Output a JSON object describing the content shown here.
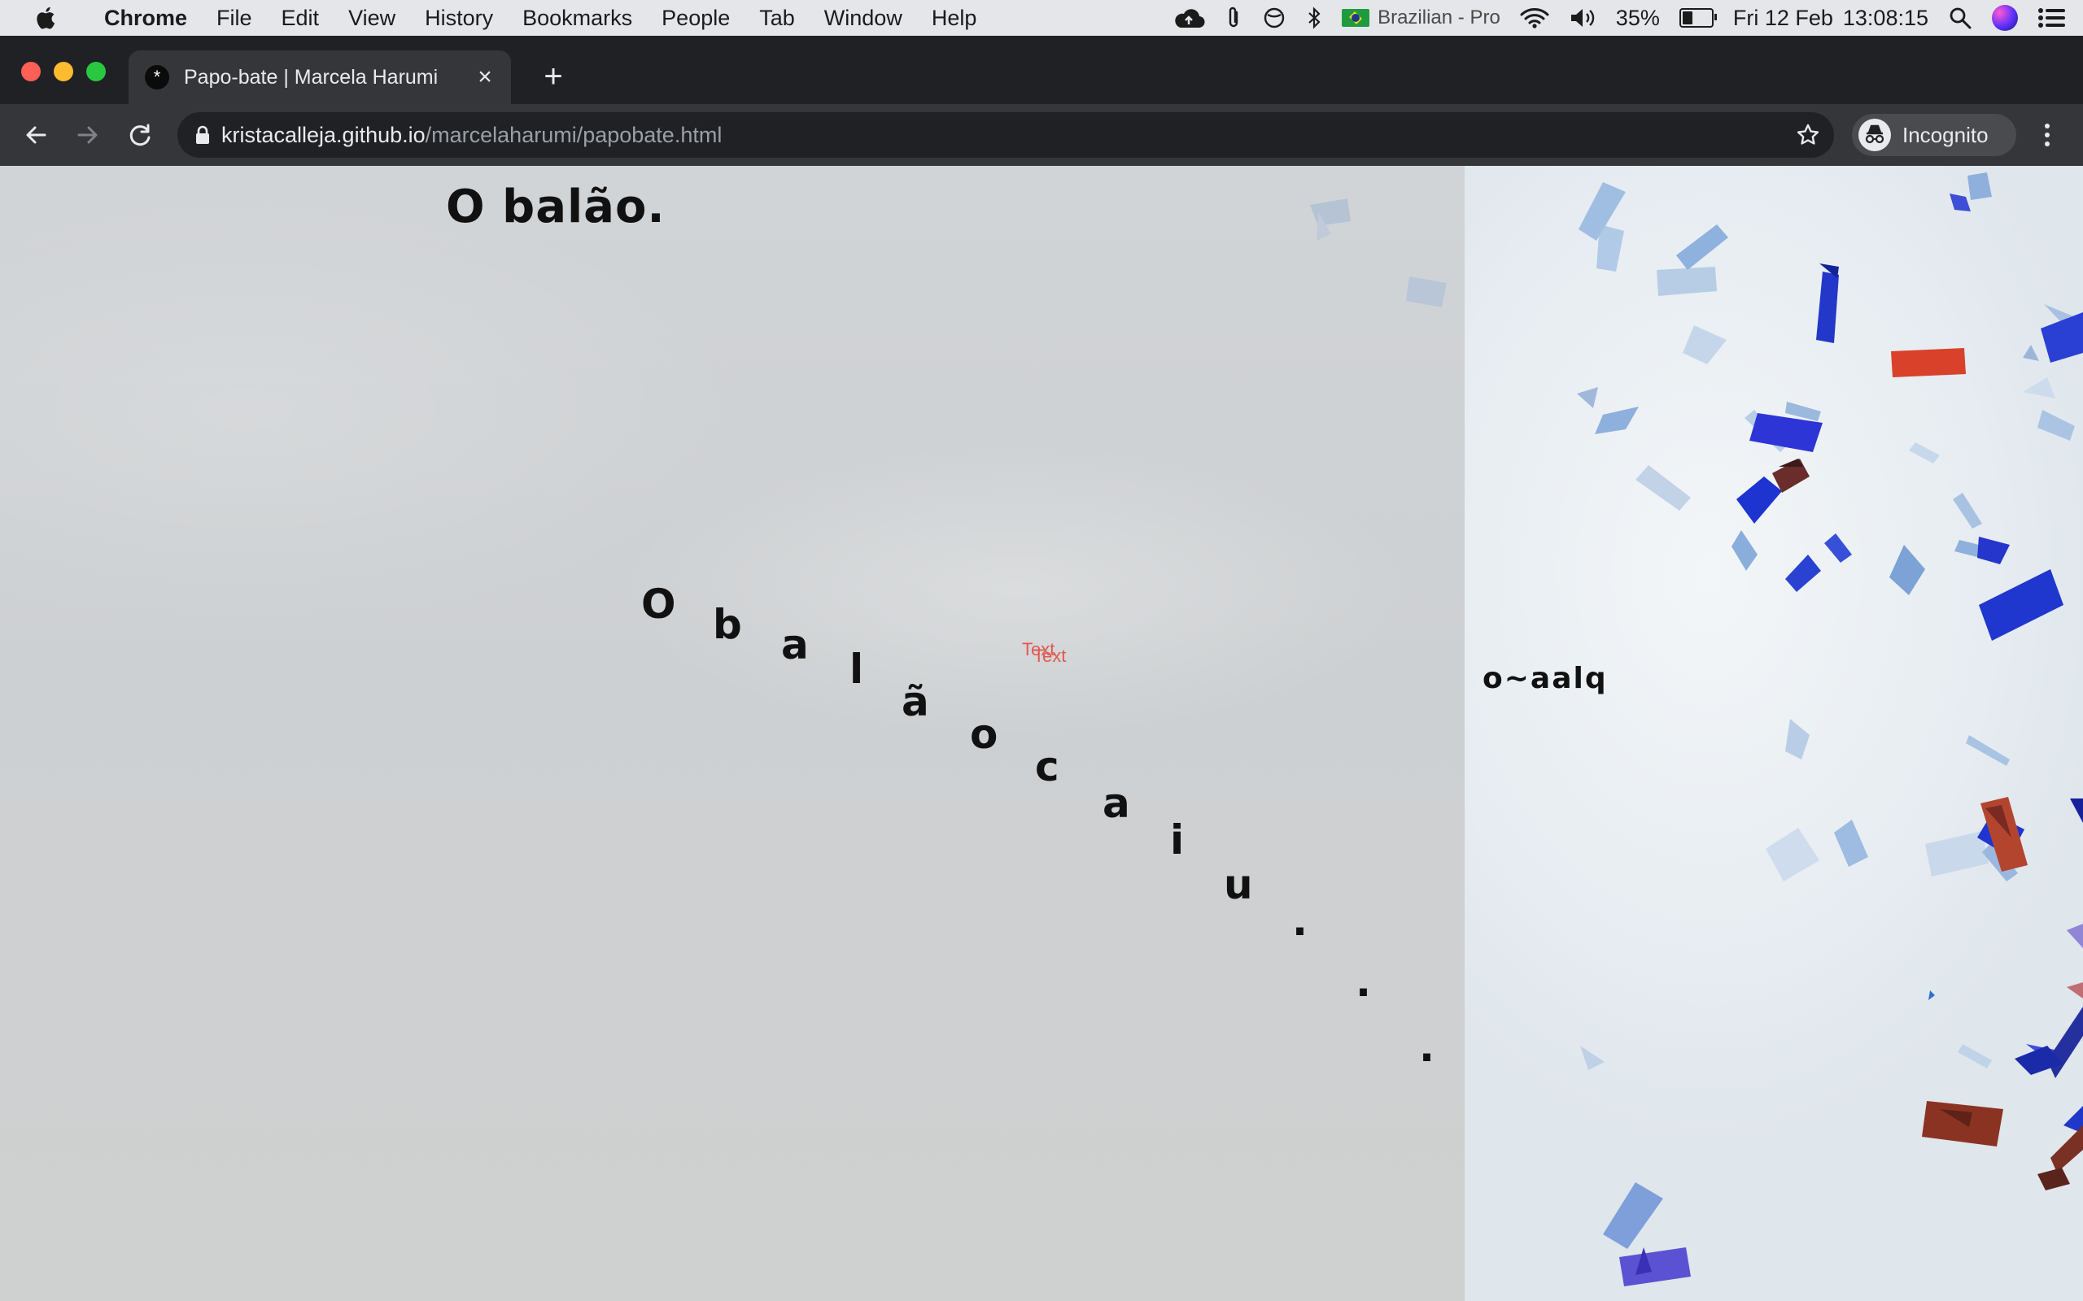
{
  "menubar": {
    "app_name": "Chrome",
    "menus": [
      "File",
      "Edit",
      "View",
      "History",
      "Bookmarks",
      "People",
      "Tab",
      "Window",
      "Help"
    ],
    "keyboard_layout": "Brazilian - Pro",
    "battery_percent": "35%",
    "battery_level": 0.35,
    "date": "Fri 12 Feb",
    "time": "13:08:15",
    "icons": [
      "apple-icon",
      "cloud-upload-icon",
      "paperclip-icon",
      "do-not-disturb-icon",
      "bluetooth-icon",
      "wifi-icon",
      "volume-icon",
      "battery-icon",
      "spotlight-search-icon",
      "siri-icon",
      "control-center-icon"
    ]
  },
  "browser": {
    "tab": {
      "favicon": "*",
      "title": "Papo-bate | Marcela Harumi",
      "close": "×"
    },
    "new_tab": "+",
    "url_host": "kristacalleja.github.io",
    "url_path": "/marcelaharumi/papobate.html",
    "profile_label": "Incognito",
    "icons": [
      "back-icon",
      "forward-icon",
      "reload-icon",
      "lock-icon",
      "bookmark-star-icon",
      "incognito-icon",
      "more-menu-icon"
    ]
  },
  "page": {
    "heading": "O balão.",
    "falling_letters": [
      "O",
      "b",
      "a",
      "l",
      "ã",
      "o",
      "c",
      "a",
      "i",
      "u",
      ".",
      ".",
      "."
    ],
    "placeholder_texts": [
      "Text",
      "Text"
    ],
    "mirrored_text": "o~aalq",
    "colors": {
      "placeholder": "#e05a52",
      "left_bg": "#cfd2d4",
      "right_bg": "#eef2f5"
    }
  }
}
